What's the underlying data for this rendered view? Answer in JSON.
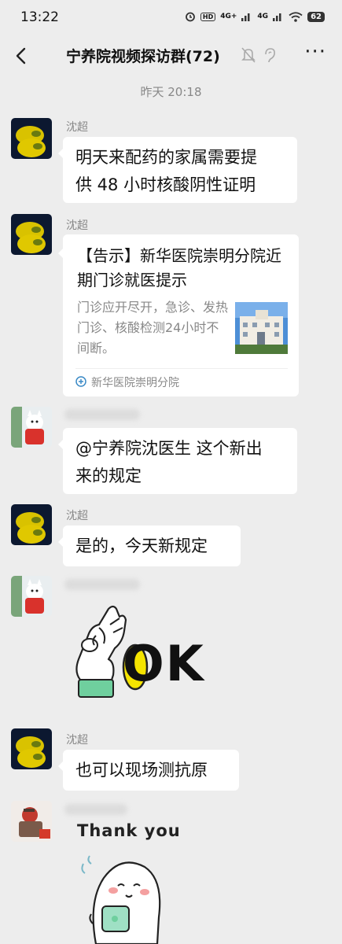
{
  "status_bar": {
    "time": "13:22",
    "hd_label": "HD",
    "network_1": "4G+",
    "network_2": "4G",
    "battery": "62"
  },
  "nav": {
    "title": "宁养院视频探访群(72)",
    "more_label": "···"
  },
  "time_separator": "昨天 20:18",
  "messages": [
    {
      "sender": "沈超",
      "text_lines": [
        "明天来配药的家属需要提",
        "供 48 小时核酸阴性证明"
      ]
    },
    {
      "sender": "沈超",
      "card": {
        "title": "【告示】新华医院崇明分院近期门诊就医提示",
        "description": "门诊应开尽开，急诊、发热门诊、核酸检测24小时不间断。",
        "source": "新华医院崇明分院"
      }
    },
    {
      "text_lines": [
        "@宁养院沈医生  这个新出",
        "来的规定"
      ]
    },
    {
      "sender": "沈超",
      "text": "是的，今天新规定"
    },
    {
      "sticker": "ok-hand",
      "sticker_text": "OK"
    },
    {
      "sender": "沈超",
      "text": "也可以现场测抗原"
    },
    {
      "sticker": "thank-you",
      "sticker_text": "Thank you"
    }
  ],
  "colors": {
    "background": "#ededed",
    "bubble": "#ffffff",
    "meta_text": "#888888",
    "ok_yellow": "#f5e400"
  }
}
